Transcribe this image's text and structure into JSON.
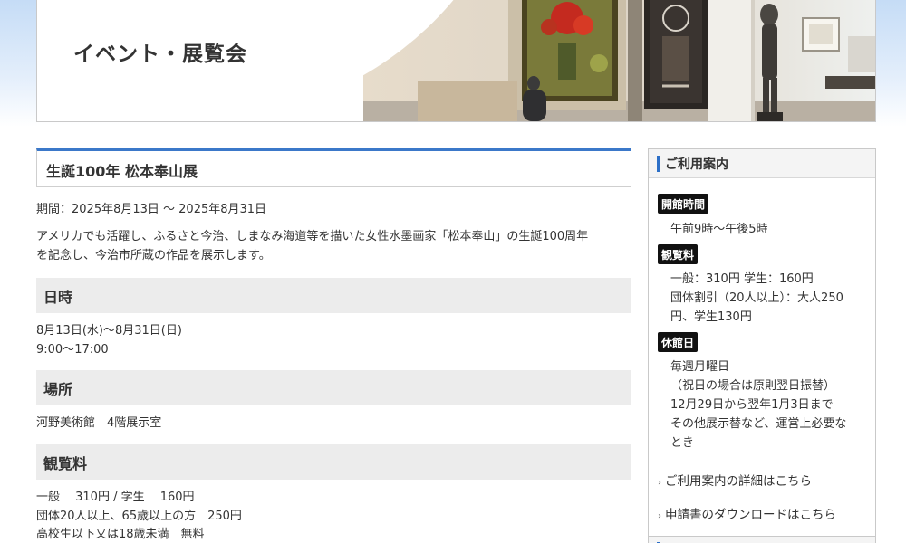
{
  "header": {
    "title": "イベント・展覧会"
  },
  "article": {
    "title": "生誕100年 松本奉山展",
    "period": "期間：2025年8月13日 〜 2025年8月31日",
    "description_line1": "アメリカでも活躍し、ふるさと今治、しまなみ海道等を描いた女性水墨画家「松本奉山」の生誕100周年",
    "description_line2": "を記念し、今治市所蔵の作品を展示します。",
    "sections": {
      "dates": {
        "heading": "日時",
        "line1": "8月13日(水)〜8月31日(日)",
        "line2": "9:00〜17:00"
      },
      "venue": {
        "heading": "場所",
        "line1": "河野美術館　4階展示室"
      },
      "fee": {
        "heading": "観覧料",
        "line1": "一般　 310円 / 学生　 160円",
        "line2": "団体20人以上、65歳以上の方　250円",
        "line3": "高校生以下又は18歳未満　無料"
      }
    }
  },
  "sidebar": {
    "heading": "ご利用案内",
    "hours_label": "開館時間",
    "hours": "午前9時〜午後5時",
    "fee_label": "観覧料",
    "fee_line1": "一般：310円 学生：160円",
    "fee_line2": "団体割引（20人以上）：大人250",
    "fee_line3": "円、学生130円",
    "closed_label": "休館日",
    "closed_line1": "毎週月曜日",
    "closed_line2": "（祝日の場合は原則翌日振替）",
    "closed_line3": "12月29日から翌年1月3日まで",
    "closed_line4": "その他展示替など、運営上必要な",
    "closed_line5": "とき",
    "link1": "ご利用案内の詳細はこちら",
    "link2": "申請書のダウンロードはこちら"
  },
  "colors": {
    "accent": "#3b78c9",
    "section_bg": "#ececec",
    "badge_bg": "#111111"
  }
}
